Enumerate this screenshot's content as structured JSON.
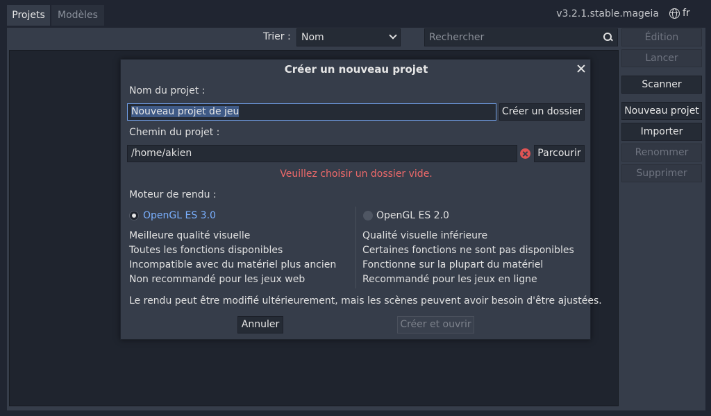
{
  "tabs": [
    {
      "label": "Projets",
      "active": true
    },
    {
      "label": "Modèles",
      "active": false
    }
  ],
  "version": "v3.2.1.stable.mageia",
  "language": "fr",
  "toolbar": {
    "sort_label": "Trier :",
    "sort_value": "Nom",
    "search_placeholder": "Rechercher"
  },
  "side_buttons": [
    {
      "label": "Édition",
      "enabled": false
    },
    {
      "label": "Lancer",
      "enabled": false
    },
    {
      "label": "Scanner",
      "enabled": true
    },
    {
      "label": "Nouveau projet",
      "enabled": true
    },
    {
      "label": "Importer",
      "enabled": true
    },
    {
      "label": "Renommer",
      "enabled": false
    },
    {
      "label": "Supprimer",
      "enabled": false
    }
  ],
  "dialog": {
    "title": "Créer un nouveau projet",
    "name_label": "Nom du projet :",
    "name_value": "Nouveau projet de jeu",
    "create_folder_label": "Créer un dossier",
    "path_label": "Chemin du projet :",
    "path_value": "/home/akien",
    "browse_label": "Parcourir",
    "error_message": "Veuillez choisir un dossier vide.",
    "renderer_label": "Moteur de rendu :",
    "renderers": [
      {
        "name": "OpenGL ES 3.0",
        "selected": true,
        "features": [
          "Meilleure qualité visuelle",
          "Toutes les fonctions disponibles",
          "Incompatible avec du matériel plus ancien",
          "Non recommandé pour les jeux web"
        ]
      },
      {
        "name": "OpenGL ES 2.0",
        "selected": false,
        "features": [
          "Qualité visuelle inférieure",
          "Certaines fonctions ne sont pas disponibles",
          "Fonctionne sur la plupart du matériel",
          "Recommandé pour les jeux en ligne"
        ]
      }
    ],
    "note": "Le rendu peut être modifié ultérieurement, mais les scènes peuvent avoir besoin d'être ajustées.",
    "cancel_label": "Annuler",
    "create_open_label": "Créer et ouvrir"
  },
  "colors": {
    "background": "#202531",
    "panel": "#363d4a",
    "accent": "#7ab0ff",
    "error": "#f06a6a"
  }
}
